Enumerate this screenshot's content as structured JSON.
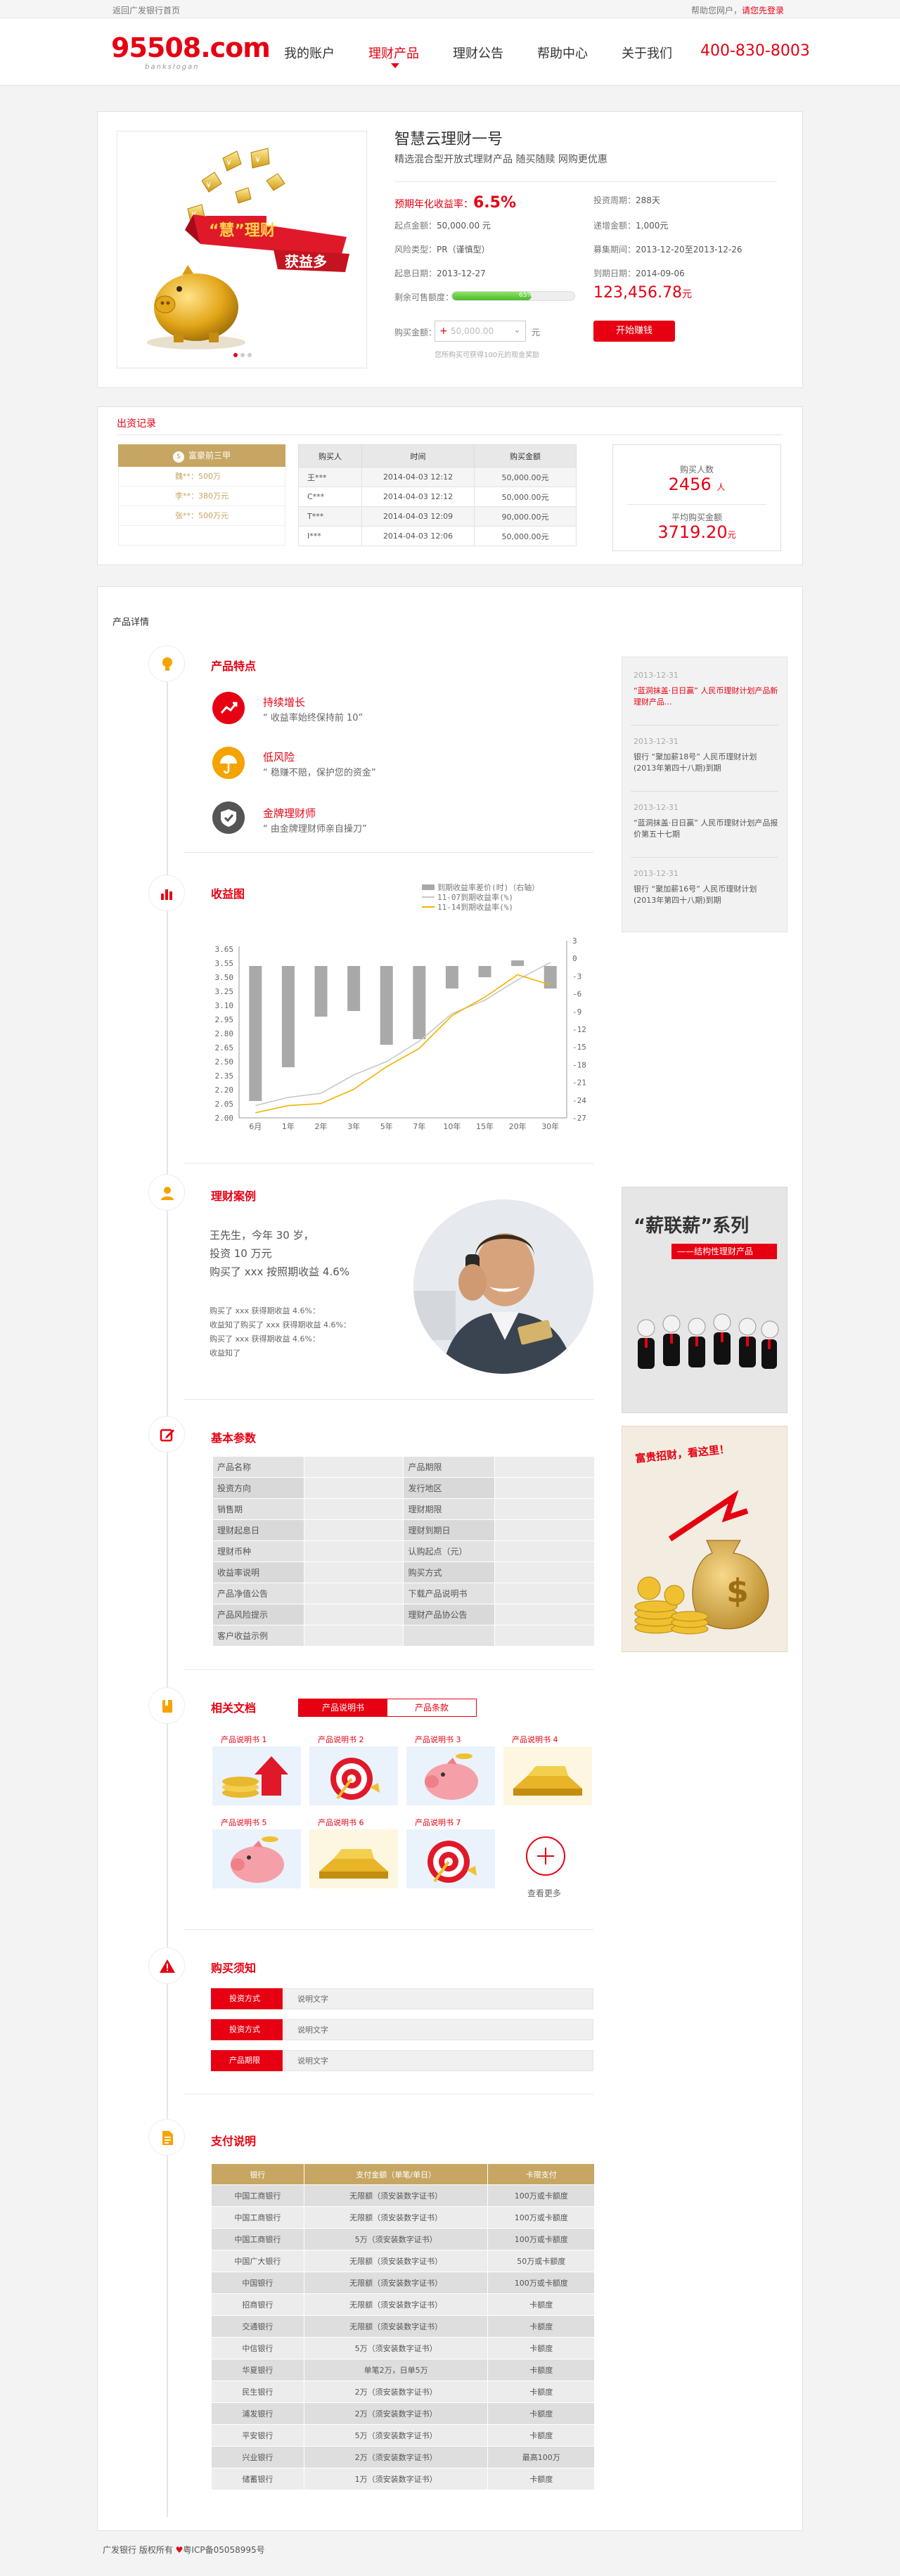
{
  "topbar": {
    "left": "返回广发银行首页",
    "right_prefix": "帮助您网户，",
    "right_login": "请您先登录"
  },
  "header": {
    "logo_text": "95508.com",
    "slogan": "bankslogan",
    "nav": [
      {
        "label": "我的账户",
        "active": false
      },
      {
        "label": "理财产品",
        "active": true
      },
      {
        "label": "理财公告",
        "active": false
      },
      {
        "label": "帮助中心",
        "active": false
      },
      {
        "label": "关于我们",
        "active": false
      }
    ],
    "hotline": "400-830-8003"
  },
  "product": {
    "banner_text1": "“慧”理财",
    "banner_text2": "获益多",
    "title": "智慧云理财一号",
    "subtitle": "精选混合型开放式理财产品  随买随赎  网购更优惠",
    "rate_label": "预期年化收益率：",
    "rate_value": "6.5%",
    "fields_left": [
      {
        "k": "起点金额：",
        "v": "50,000.00 元"
      },
      {
        "k": "风险类型：",
        "v": "PR（谨慎型）"
      },
      {
        "k": "起息日期：",
        "v": "2013-12-27"
      },
      {
        "k": "剩余可售额度：",
        "v": ""
      },
      {
        "k": "购买金额：",
        "v": ""
      }
    ],
    "fields_right": [
      {
        "k": "投资周期：",
        "v": "288天"
      },
      {
        "k": "递增金额：",
        "v": "1,000元"
      },
      {
        "k": "募集期间：",
        "v": "2013-12-20至2013-12-26"
      },
      {
        "k": "到期日期：",
        "v": "2014-09-06"
      }
    ],
    "progress_label": "65%",
    "progress": 0.65,
    "remain_value": "123,456.78",
    "remain_unit": "元",
    "amount_placeholder": "50,000.00",
    "amount_unit": "元",
    "buy_label": "开始赚钱",
    "hint": "您所购买可获得100元的现金奖励"
  },
  "records": {
    "title": "出资记录",
    "rank_header": "富豪前三甲",
    "rank_rows": [
      "魏**：500万",
      "李**：380万元",
      "张**：500万元"
    ],
    "table_headers": [
      "购买人",
      "时间",
      "购买金额"
    ],
    "table_rows": [
      [
        "王***",
        "2014-04-03  12:12",
        "50,000.00元"
      ],
      [
        "C***",
        "2014-04-03  12:12",
        "50,000.00元"
      ],
      [
        "T***",
        "2014-04-03  12:09",
        "90,000.00元"
      ],
      [
        "I***",
        "2014-04-03  12:06",
        "50,000.00元"
      ]
    ],
    "stat_buyers_label": "购买人数",
    "stat_buyers_value": "2456",
    "stat_buyers_unit": "人",
    "stat_avg_label": "平均购买金额",
    "stat_avg_value": "3719.20",
    "stat_avg_unit": "元"
  },
  "details": {
    "title": "产品详情",
    "features": {
      "title": "产品特点",
      "items": [
        {
          "t": "持续增长",
          "d": "“ 收益率始终保持前 10”"
        },
        {
          "t": "低风险",
          "d": "“ 稳赚不赔，保护您的资金”"
        },
        {
          "t": "金牌理财师",
          "d": "“ 由金牌理财师亲自操刀”"
        }
      ]
    },
    "news": [
      {
        "d": "2013-12-31",
        "t": "“蓝洞抹盖·日日赢” 人民币理财计划产品新理财产品...",
        "hl": true
      },
      {
        "d": "2013-12-31",
        "t": "银行 “聚加薪18号” 人民币理财计划(2013年第四十八期)到期",
        "hl": false
      },
      {
        "d": "2013-12-31",
        "t": "“蓝洞抹盖·日日赢” 人民币理财计划产品报价第五十七期",
        "hl": false
      },
      {
        "d": "2013-12-31",
        "t": "银行 “聚加薪16号” 人民币理财计划(2013年第四十八期)到期",
        "hl": false
      }
    ],
    "chart_title": "收益图",
    "case": {
      "title": "理财案例",
      "lines": [
        "王先生，今年 30 岁，",
        "投资 10 万元",
        "购买了 xxx 按照期收益 4.6%"
      ],
      "small": [
        "购买了 xxx 获得期收益 4.6%：",
        "收益知了购买了 xxx 获得期收益 4.6%：",
        "购买了 xxx 获得期收益 4.6%：",
        "收益知了"
      ]
    },
    "ad1": {
      "title": "“薪联薪”系列",
      "sub": "——结构性理财产品"
    },
    "ad2": {
      "title": "富贵招财，看这里！"
    },
    "params": {
      "title": "基本参数",
      "rows": [
        [
          "产品名称",
          "",
          "产品期限",
          ""
        ],
        [
          "投资方向",
          "",
          "发行地区",
          ""
        ],
        [
          "销售期",
          "",
          "理财期限",
          ""
        ],
        [
          "理财起息日",
          "",
          "理财到期日",
          ""
        ],
        [
          "理财币种",
          "",
          "认购起点（元）",
          ""
        ],
        [
          "收益率说明",
          "",
          "购买方式",
          ""
        ],
        [
          "产品净值公告",
          "",
          "下载产品说明书",
          ""
        ],
        [
          "产品风险提示",
          "",
          "理财产品协公告",
          ""
        ],
        [
          "客户收益示例",
          "",
          "",
          ""
        ]
      ]
    },
    "docs": {
      "title": "相关文档",
      "tab_on": "产品说明书",
      "tab_off": "产品条款",
      "items": [
        "产品说明书 1",
        "产品说明书 2",
        "产品说明书 3",
        "产品说明书 4",
        "产品说明书 5",
        "产品说明书 6",
        "产品说明书 7"
      ],
      "more": "查看更多"
    },
    "notice": {
      "title": "购买须知",
      "rows": [
        {
          "k": "投资方式",
          "v": "说明文字"
        },
        {
          "k": "投资方式",
          "v": "说明文字"
        },
        {
          "k": "产品期限",
          "v": "说明文字"
        }
      ]
    },
    "pay": {
      "title": "支付说明",
      "headers": [
        "银行",
        "支付金额（单笔/单日）",
        "卡限支付"
      ],
      "rows": [
        [
          "中国工商银行",
          "无限额（须安装数字证书）",
          "100万或卡额度"
        ],
        [
          "中国工商银行",
          "无限额（须安装数字证书）",
          "100万或卡额度"
        ],
        [
          "中国工商银行",
          "5万（须安装数字证书）",
          "100万或卡额度"
        ],
        [
          "中国广大银行",
          "无限额（须安装数字证书）",
          "50万或卡额度"
        ],
        [
          "中国银行",
          "无限额（须安装数字证书）",
          "100万或卡额度"
        ],
        [
          "招商银行",
          "无限额（须安装数字证书）",
          "卡额度"
        ],
        [
          "交通银行",
          "无限额（须安装数字证书）",
          "卡额度"
        ],
        [
          "中信银行",
          "5万（须安装数字证书）",
          "卡额度"
        ],
        [
          "华夏银行",
          "单笔2万，日单5万",
          "卡额度"
        ],
        [
          "民生银行",
          "2万（须安装数字证书）",
          "卡额度"
        ],
        [
          "浦发银行",
          "2万（须安装数字证书）",
          "卡额度"
        ],
        [
          "平安银行",
          "5万（须安装数字证书）",
          "卡额度"
        ],
        [
          "兴业银行",
          "2万（须安装数字证书）",
          "最高100万"
        ],
        [
          "储蓄银行",
          "1万（须安装数字证书）",
          "卡额度"
        ]
      ]
    }
  },
  "footer": {
    "text1": "广发银行  版权所有",
    "text2": "粤ICP备05058995号"
  },
  "chart_data": {
    "type": "bar",
    "title": "",
    "legend": [
      "到期收益率差价(时)（右轴）",
      "11-07到期收益率(%)",
      "11-14到期收益率(%)"
    ],
    "categories": [
      "6月",
      "1年",
      "2年",
      "3年",
      "5年",
      "7年",
      "10年",
      "15年",
      "20年",
      "30年"
    ],
    "ylim_left": [
      2.0,
      3.65
    ],
    "yticks_left": [
      "3.65",
      "3.55",
      "3.50",
      "3.25",
      "3.10",
      "2.95",
      "2.80",
      "2.65",
      "2.50",
      "2.35",
      "2.20",
      "2.05",
      "2.00"
    ],
    "ylim_right": [
      -27,
      3
    ],
    "yticks_right": [
      "3",
      "0",
      "-3",
      "-6",
      "-9",
      "-12",
      "-15",
      "-18",
      "-21",
      "-24",
      "-27"
    ],
    "series": [
      {
        "name": "到期收益率差价(时)（右轴）",
        "axis": "right",
        "values": [
          -24,
          -18,
          -9,
          -8,
          -14,
          -13,
          -4,
          -2,
          1,
          -4
        ]
      },
      {
        "name": "11-07到期收益率(%)",
        "axis": "left",
        "values": [
          2.12,
          2.2,
          2.24,
          2.42,
          2.55,
          2.75,
          3.02,
          3.15,
          3.35,
          3.52
        ]
      },
      {
        "name": "11-14到期收益率(%)",
        "axis": "left",
        "values": [
          2.05,
          2.12,
          2.14,
          2.28,
          2.5,
          2.68,
          3.0,
          3.18,
          3.4,
          3.3
        ]
      }
    ],
    "colors": [
      "#a9a9a9",
      "#c8c8c8",
      "#f0b400"
    ]
  }
}
